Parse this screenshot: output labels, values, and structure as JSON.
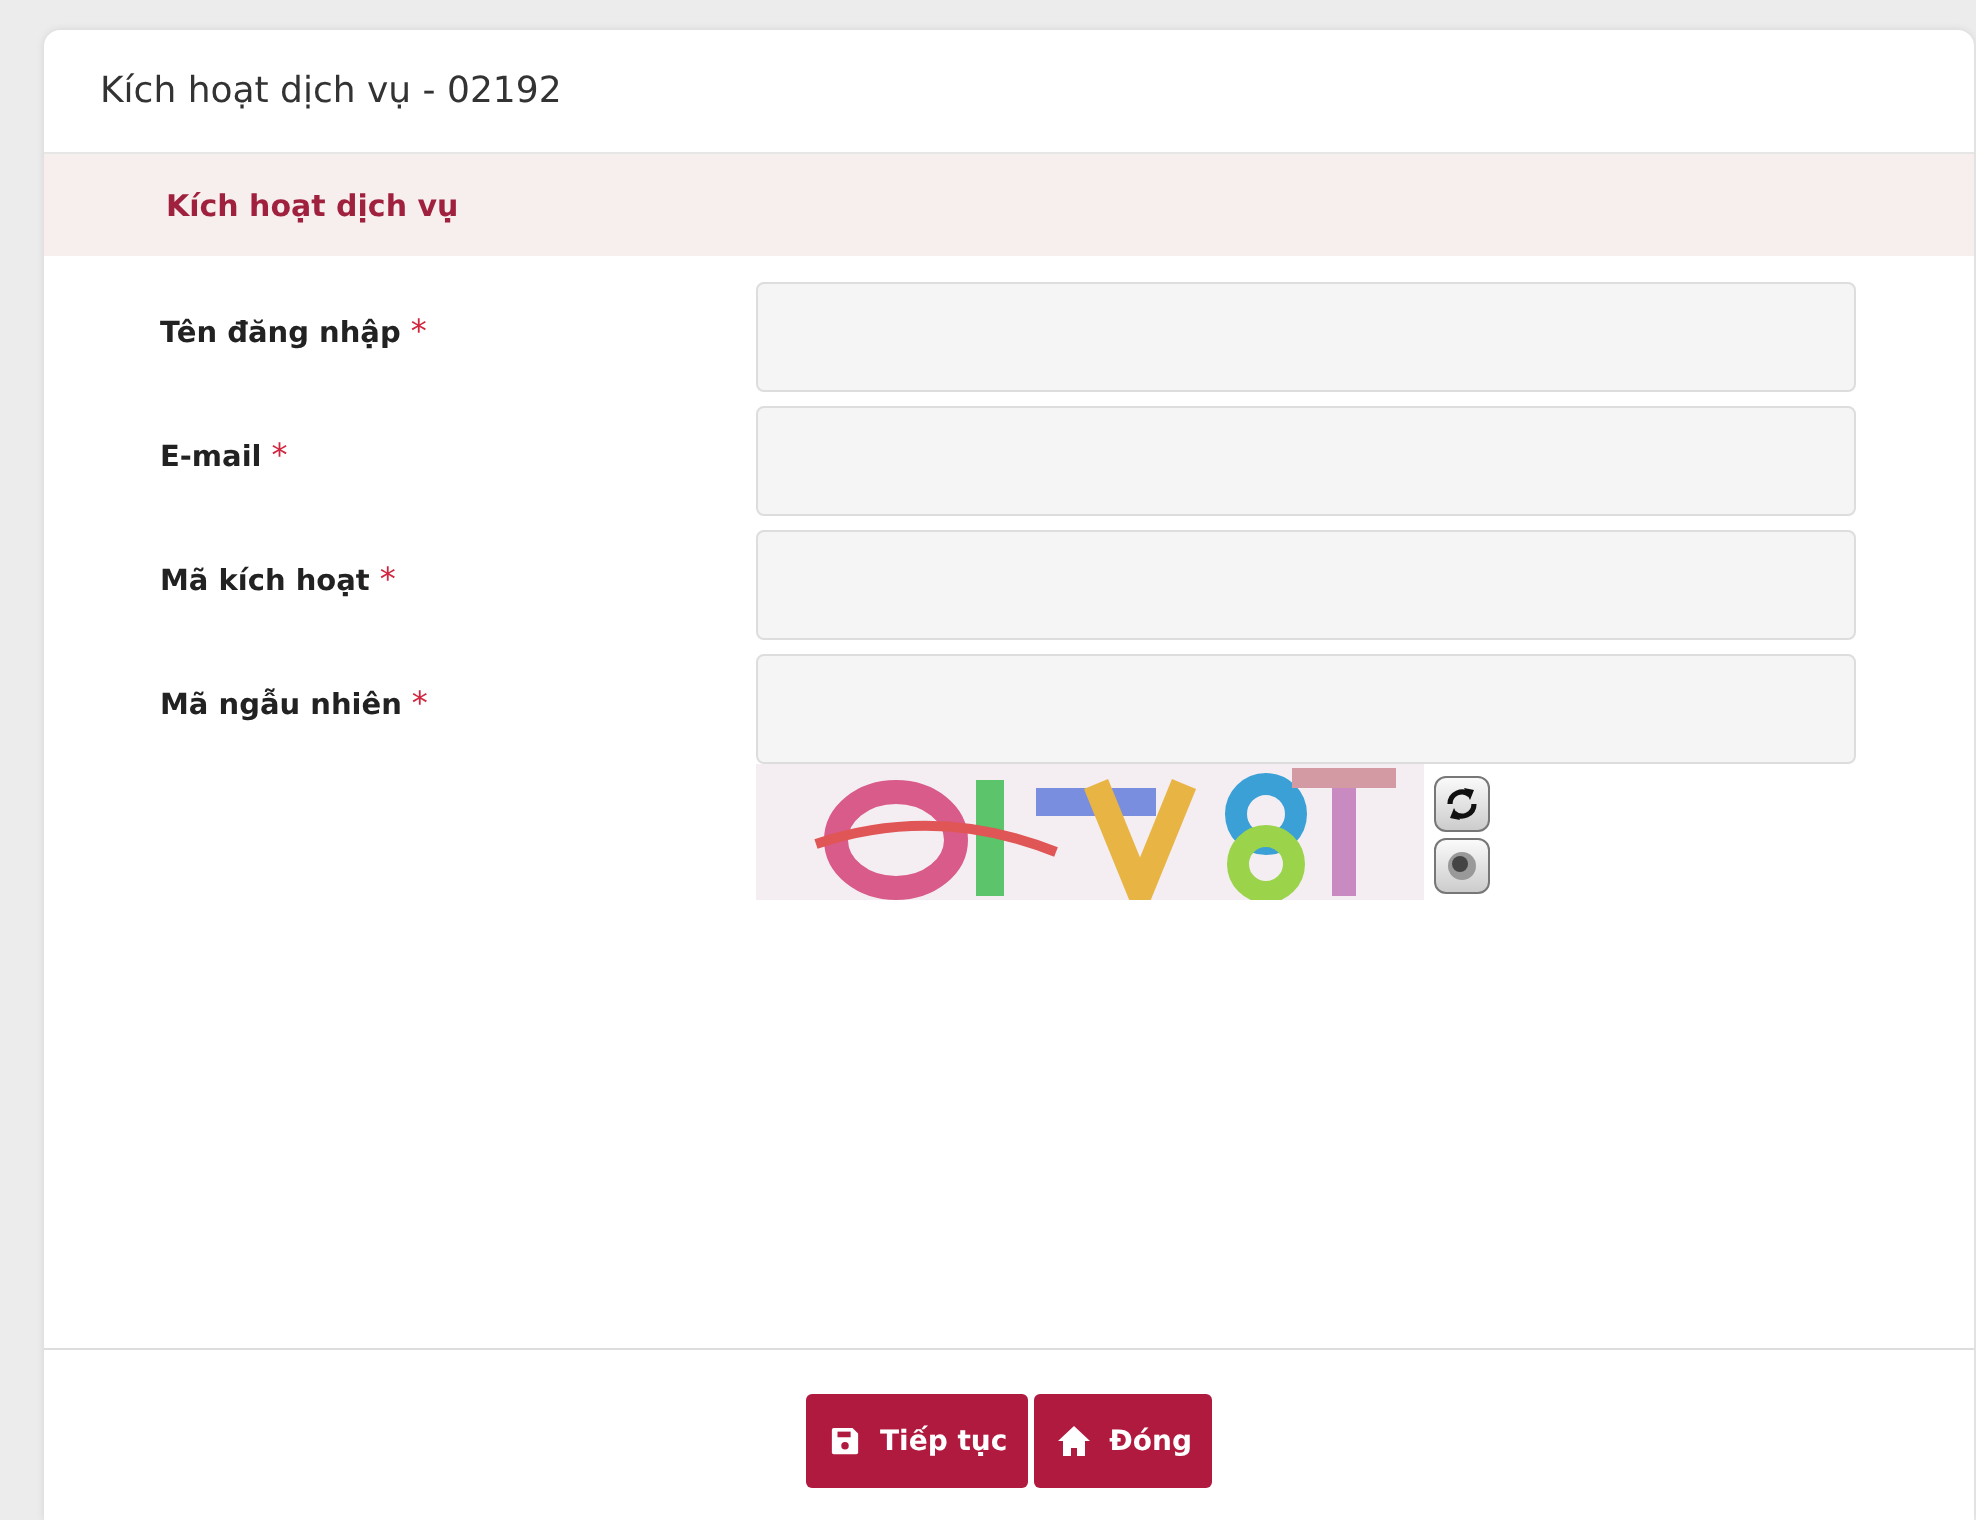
{
  "dialog": {
    "title": "Kích hoạt dịch vụ - 02192"
  },
  "section": {
    "title": "Kích hoạt dịch vụ"
  },
  "fields": [
    {
      "label": "Tên đăng nhập",
      "required_mark": "*"
    },
    {
      "label": "E-mail",
      "required_mark": "*"
    },
    {
      "label": "Mã kích hoạt",
      "required_mark": "*"
    },
    {
      "label": "Mã ngẫu nhiên",
      "required_mark": "*"
    }
  ],
  "buttons": [
    {
      "label": "Tiếp tục",
      "kind": "save"
    },
    {
      "label": "Đóng",
      "kind": "home"
    }
  ]
}
